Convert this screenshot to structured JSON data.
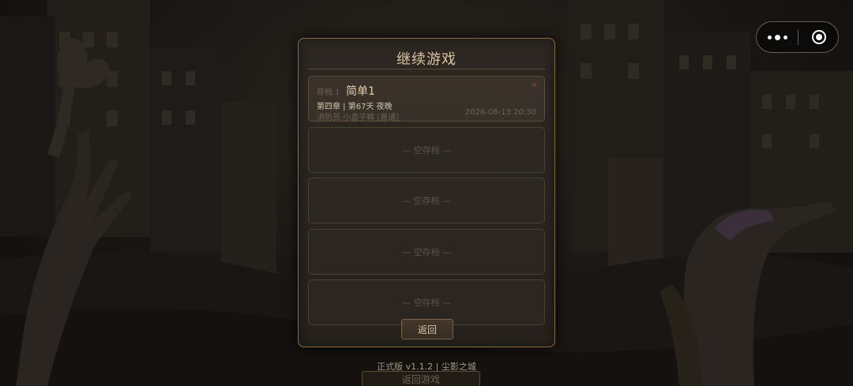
{
  "capsule": {
    "more_icon": "more-dots-icon",
    "close_icon": "target-close-icon"
  },
  "background": {
    "version_text": "正式版 v1.1.2 | 尘影之城",
    "menu_button_label": "返回游戏"
  },
  "dialog": {
    "title": "继续游戏",
    "slots": [
      {
        "index_label": "存档 1",
        "name": "简单1",
        "progress": "第四章 | 第67天 夜晚",
        "role": "消防员  小盒子精 [普通]",
        "time": "2026-08-13 20:30",
        "delete_label": "×"
      },
      {
        "empty_label": "— 空存档 —"
      },
      {
        "empty_label": "— 空存档 —"
      },
      {
        "empty_label": "— 空存档 —"
      },
      {
        "empty_label": "— 空存档 —"
      }
    ],
    "back_label": "返回"
  }
}
